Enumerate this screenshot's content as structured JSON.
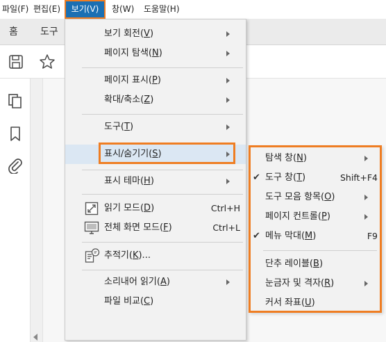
{
  "menubar": {
    "items": [
      {
        "label": "파일(F)"
      },
      {
        "label": "편집(E)"
      },
      {
        "label": "보기(V)"
      },
      {
        "label": "창(W)"
      },
      {
        "label": "도움말(H)"
      }
    ]
  },
  "tabs": {
    "home": "홈",
    "tools": "도구"
  },
  "view_menu": {
    "rotate": {
      "text": "보기 회전(",
      "key": "V",
      "end": ")"
    },
    "page_nav": {
      "text": "페이지 탐색(",
      "key": "N",
      "end": ")"
    },
    "page_display": {
      "text": "페이지 표시(",
      "key": "P",
      "end": ")"
    },
    "zoom": {
      "text": "확대/축소(",
      "key": "Z",
      "end": ")"
    },
    "tools": {
      "text": "도구(",
      "key": "T",
      "end": ")"
    },
    "show_hide": {
      "text": "표시/숨기기(",
      "key": "S",
      "end": ")"
    },
    "display_theme": {
      "text": "표시 테마(",
      "key": "H",
      "end": ")"
    },
    "read_mode": {
      "text": "읽기 모드(",
      "key": "D",
      "end": ")",
      "shortcut": "Ctrl+H"
    },
    "full_screen": {
      "text": "전체 화면 모드(",
      "key": "F",
      "end": ")",
      "shortcut": "Ctrl+L"
    },
    "tracker": {
      "text": "추적기(",
      "key": "K",
      "end": ")..."
    },
    "read_aloud": {
      "text": "소리내어 읽기(",
      "key": "A",
      "end": ")"
    },
    "compare": {
      "text": "파일 비교(",
      "key": "C",
      "end": ")"
    }
  },
  "show_hide_submenu": {
    "nav_pane": {
      "text": "탐색 창(",
      "key": "N",
      "end": ")"
    },
    "tools_pane": {
      "text": "도구 창(",
      "key": "T",
      "end": ")",
      "shortcut": "Shift+F4",
      "checked": "✔"
    },
    "toolbar_items": {
      "text": "도구 모음 항목(",
      "key": "O",
      "end": ")"
    },
    "page_controls": {
      "text": "페이지 컨트롤(",
      "key": "P",
      "end": ")"
    },
    "menu_bar": {
      "text": "메뉴 막대(",
      "key": "M",
      "end": ")",
      "shortcut": "F9",
      "checked": "✔"
    },
    "cursor_layer": {
      "text": "단추 레이블(",
      "key": "B",
      "end": ")"
    },
    "rulers_grids": {
      "text": "눈금자 및 격자(",
      "key": "R",
      "end": ")"
    },
    "cursor_coords": {
      "text": "커서 좌표(",
      "key": "U",
      "end": ")"
    }
  },
  "colors": {
    "accent": "#1a6fb3",
    "highlight_outline": "#ef7d22",
    "menu_bg": "#f2f2f2",
    "hover": "#dbe7f3"
  },
  "icons": [
    "save-icon",
    "star-icon",
    "pages-icon",
    "bookmark-icon",
    "paperclip-icon",
    "read-mode-icon",
    "full-screen-icon",
    "tracker-icon",
    "checkmark-icon",
    "submenu-arrow-icon"
  ]
}
